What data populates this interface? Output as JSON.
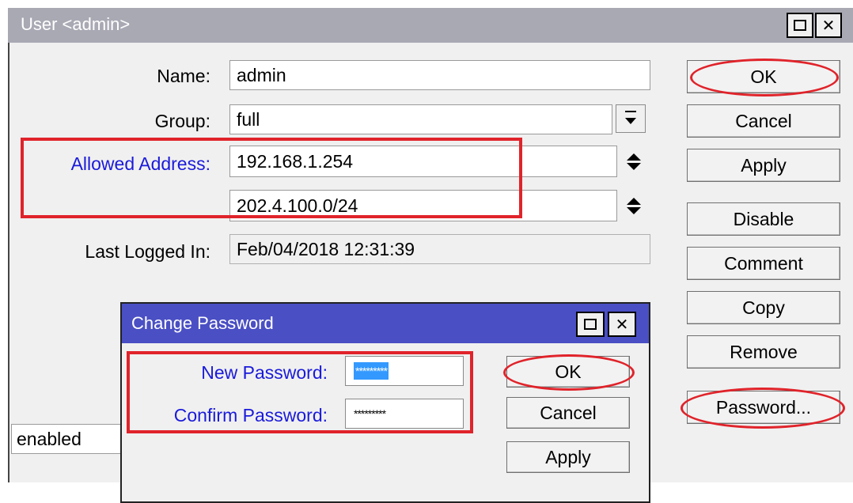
{
  "main_window": {
    "title": "User <admin>",
    "fields": {
      "name_label": "Name:",
      "name_value": "admin",
      "group_label": "Group:",
      "group_value": "full",
      "allowed_address_label": "Allowed Address:",
      "allowed_address_1": "192.168.1.254",
      "allowed_address_2": "202.4.100.0/24",
      "last_logged_in_label": "Last Logged In:",
      "last_logged_in_value": "Feb/04/2018 12:31:39"
    },
    "buttons": {
      "ok": "OK",
      "cancel": "Cancel",
      "apply": "Apply",
      "disable": "Disable",
      "comment": "Comment",
      "copy": "Copy",
      "remove": "Remove",
      "password": "Password..."
    },
    "status": "enabled"
  },
  "change_password_dialog": {
    "title": "Change Password",
    "new_password_label": "New Password:",
    "new_password_value": "*********",
    "confirm_password_label": "Confirm Password:",
    "confirm_password_value": "*********",
    "buttons": {
      "ok": "OK",
      "cancel": "Cancel",
      "apply": "Apply"
    }
  },
  "colors": {
    "main_titlebar": "#a9a9b4",
    "dialog_titlebar": "#4a4fc4",
    "label_highlight": "#1a1adb",
    "annotation": "#e0232a",
    "selection": "#3399ff"
  }
}
